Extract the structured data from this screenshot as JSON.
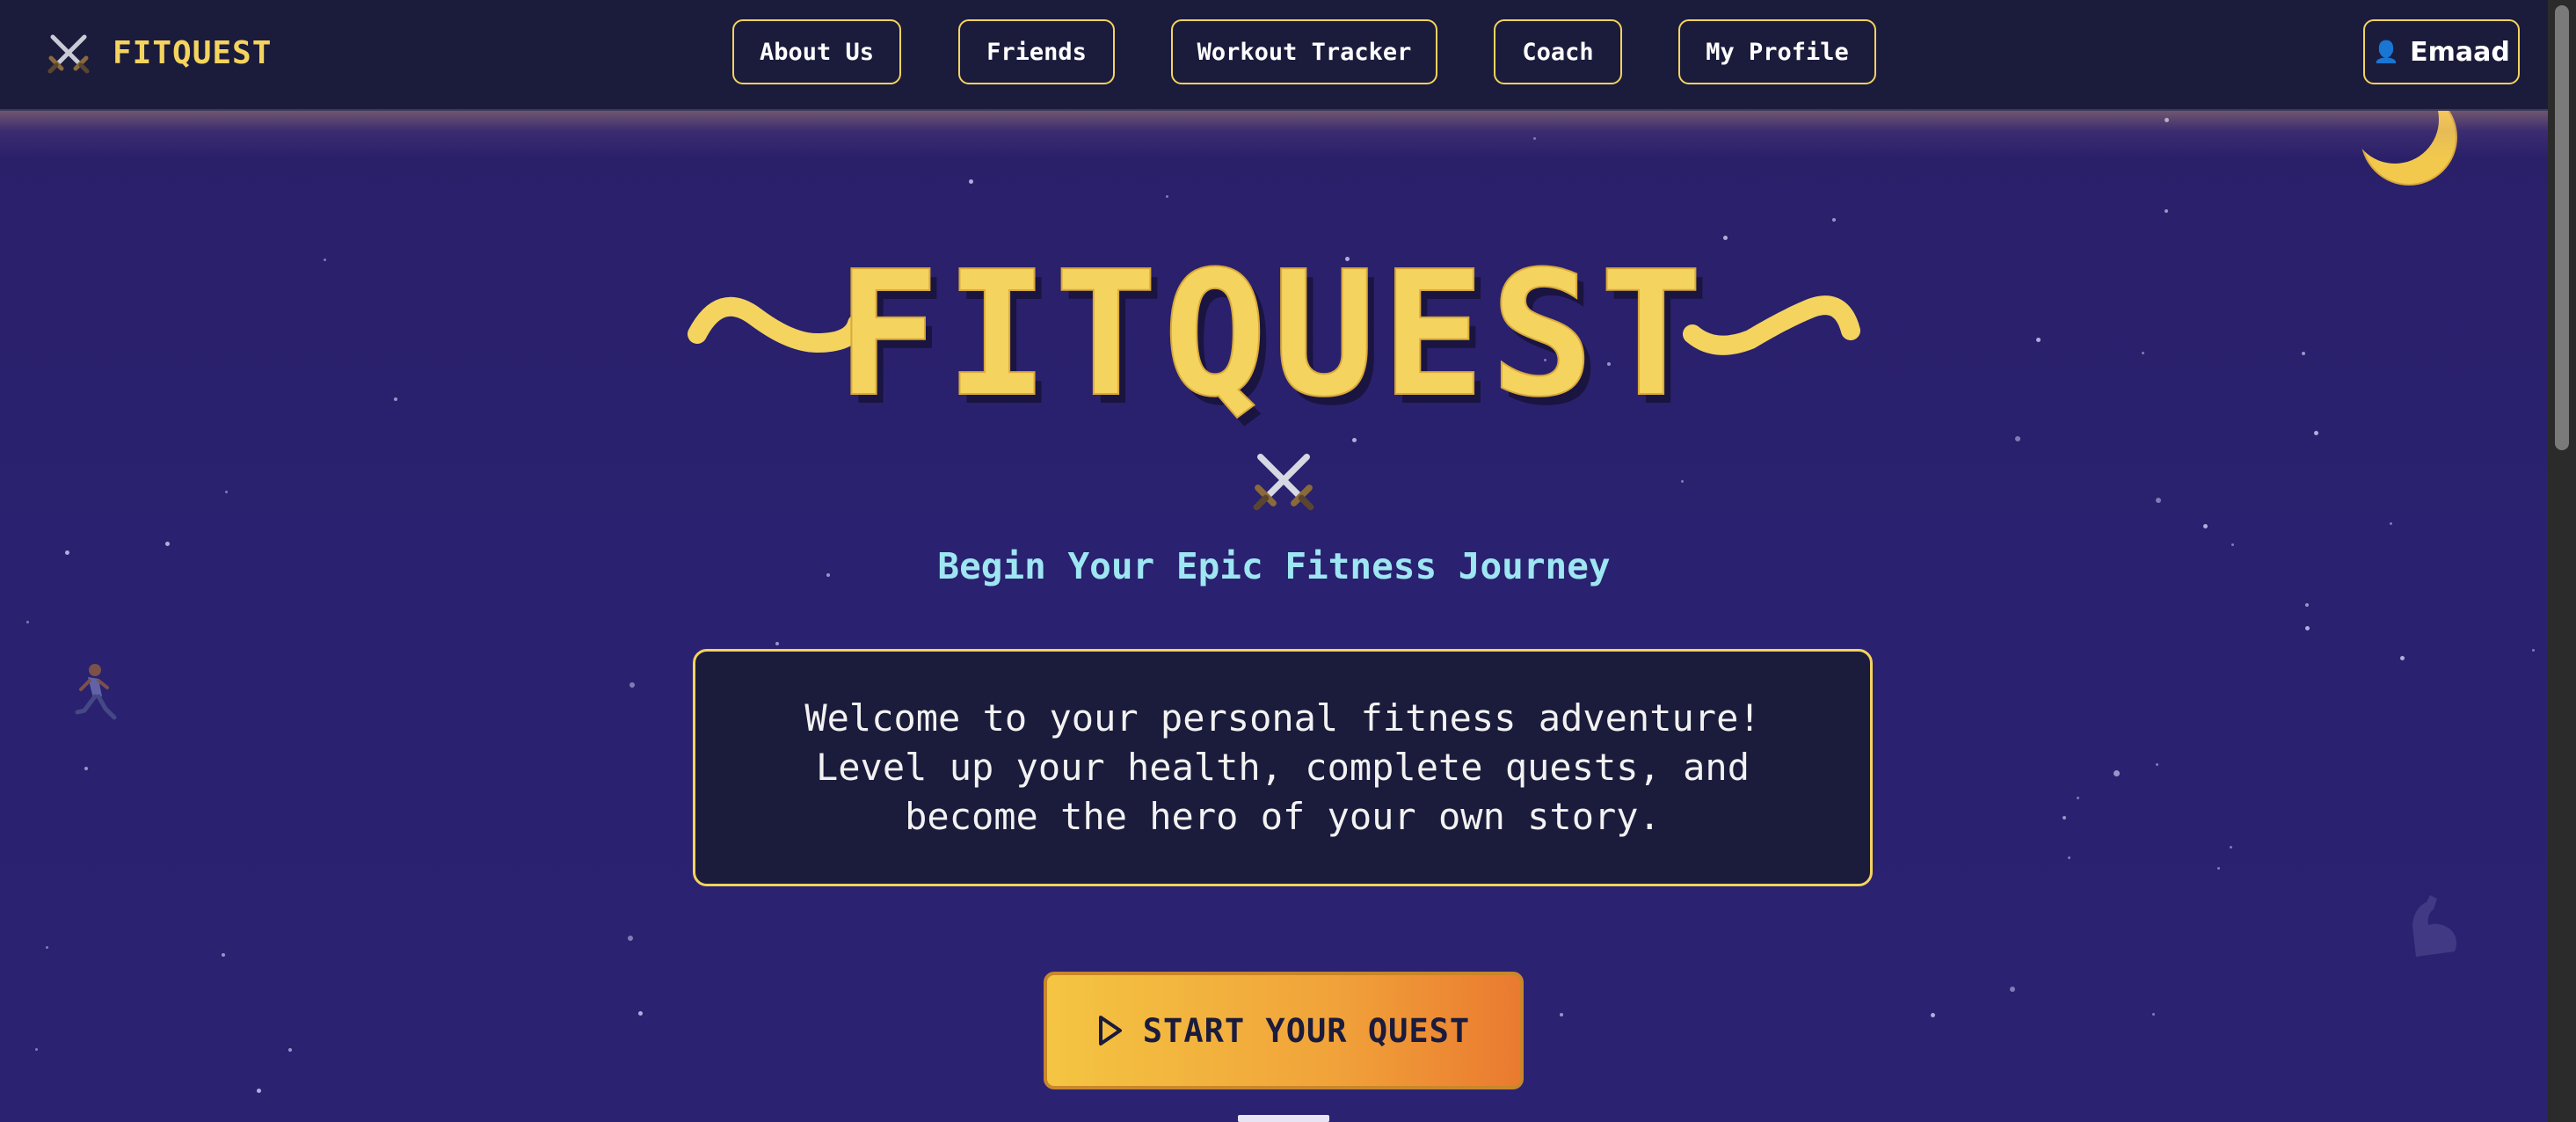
{
  "app": {
    "brand_name": "FITQUEST",
    "brand_icon": "crossed-swords-icon"
  },
  "nav": {
    "items": [
      {
        "label": "About Us"
      },
      {
        "label": "Friends"
      },
      {
        "label": "Workout Tracker"
      },
      {
        "label": "Coach"
      },
      {
        "label": "My Profile"
      }
    ],
    "user": {
      "icon": "user-icon",
      "name": "Emaad"
    }
  },
  "hero": {
    "title": "FITQUEST",
    "title_icon": "crossed-swords-icon",
    "subtitle": "Begin Your Epic Fitness Journey",
    "welcome": "Welcome to your personal fitness adventure! Level up your health, complete quests, and become the hero of your own story.",
    "cta_label": "START YOUR QUEST",
    "cta_icon": "play-icon"
  },
  "decor": {
    "moon_icon": "crescent-moon-icon",
    "runner_icon": "runner-icon",
    "flex_icon": "flexed-arm-icon"
  },
  "colors": {
    "background": "#2a2068",
    "navbar": "#1b1b3c",
    "accent_gold": "#f4d35e",
    "subtitle_cyan": "#9ee6f2",
    "cta_start": "#f4c542",
    "cta_end": "#ea7a30"
  }
}
